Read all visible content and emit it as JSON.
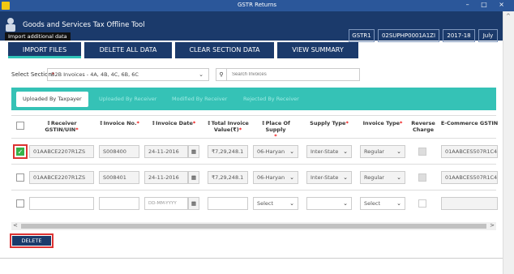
{
  "window": {
    "title": "GSTR Returns",
    "controls": [
      "–",
      "□",
      "×"
    ]
  },
  "header": {
    "app_title": "Goods and Services Tax Offline Tool",
    "tooltip": "Import additional data",
    "return_type": "GSTR1",
    "gstin": "02SUPHP0001A1ZI",
    "year": "2017-18",
    "month": "July"
  },
  "actions": {
    "import": "IMPORT FILES",
    "delete_all": "DELETE ALL DATA",
    "clear_section": "CLEAR SECTION DATA",
    "view_summary": "VIEW SUMMARY"
  },
  "section": {
    "label": "Select Section",
    "value": "B2B Invoices - 4A, 4B, 4C, 6B, 6C",
    "search_placeholder": "Search Invoices"
  },
  "tabs": [
    "Uploaded By Taxpayer",
    "Uploaded By Receiver",
    "Modified By Receiver",
    "Rejected By Receiver"
  ],
  "columns": {
    "receiver_gstin": "↕Receiver GSTIN/UIN",
    "invoice_no": "↕Invoice No.",
    "invoice_date": "↕Invoice Date",
    "total_value_1": "↕Total Invoice",
    "total_value_2": "Value(₹)",
    "place_of_supply": "↕Place Of Supply",
    "supply_type": "Supply Type",
    "invoice_type": "Invoice Type",
    "reverse_charge_1": "Reverse",
    "reverse_charge_2": "Charge",
    "ecommerce_gstin": "E-Commerce GSTIN"
  },
  "rows": [
    {
      "checked": true,
      "gstin": "01AABCE2207R1ZS",
      "invoice_no": "S008400",
      "date": "24-11-2016",
      "value": "₹7,29,248.1",
      "pos": "06-Haryan",
      "supply": "Inter-State",
      "inv_type": "Regular",
      "ecom": "01AABCES507R1C4"
    },
    {
      "checked": false,
      "gstin": "01AABCE2207R1ZS",
      "invoice_no": "S008401",
      "date": "24-11-2016",
      "value": "₹7,29,248.1",
      "pos": "06-Haryan",
      "supply": "Inter-State",
      "inv_type": "Regular",
      "ecom": "01AABCES507R1C4"
    }
  ],
  "new_row": {
    "date_placeholder": "DD-MM-YYYY",
    "pos": "Select",
    "inv_type": "Select"
  },
  "delete_label": "DELETE",
  "colors": {
    "navy": "#1b3a6b",
    "teal": "#35c2b6",
    "highlight": "#d33333",
    "check": "#35b34a"
  }
}
